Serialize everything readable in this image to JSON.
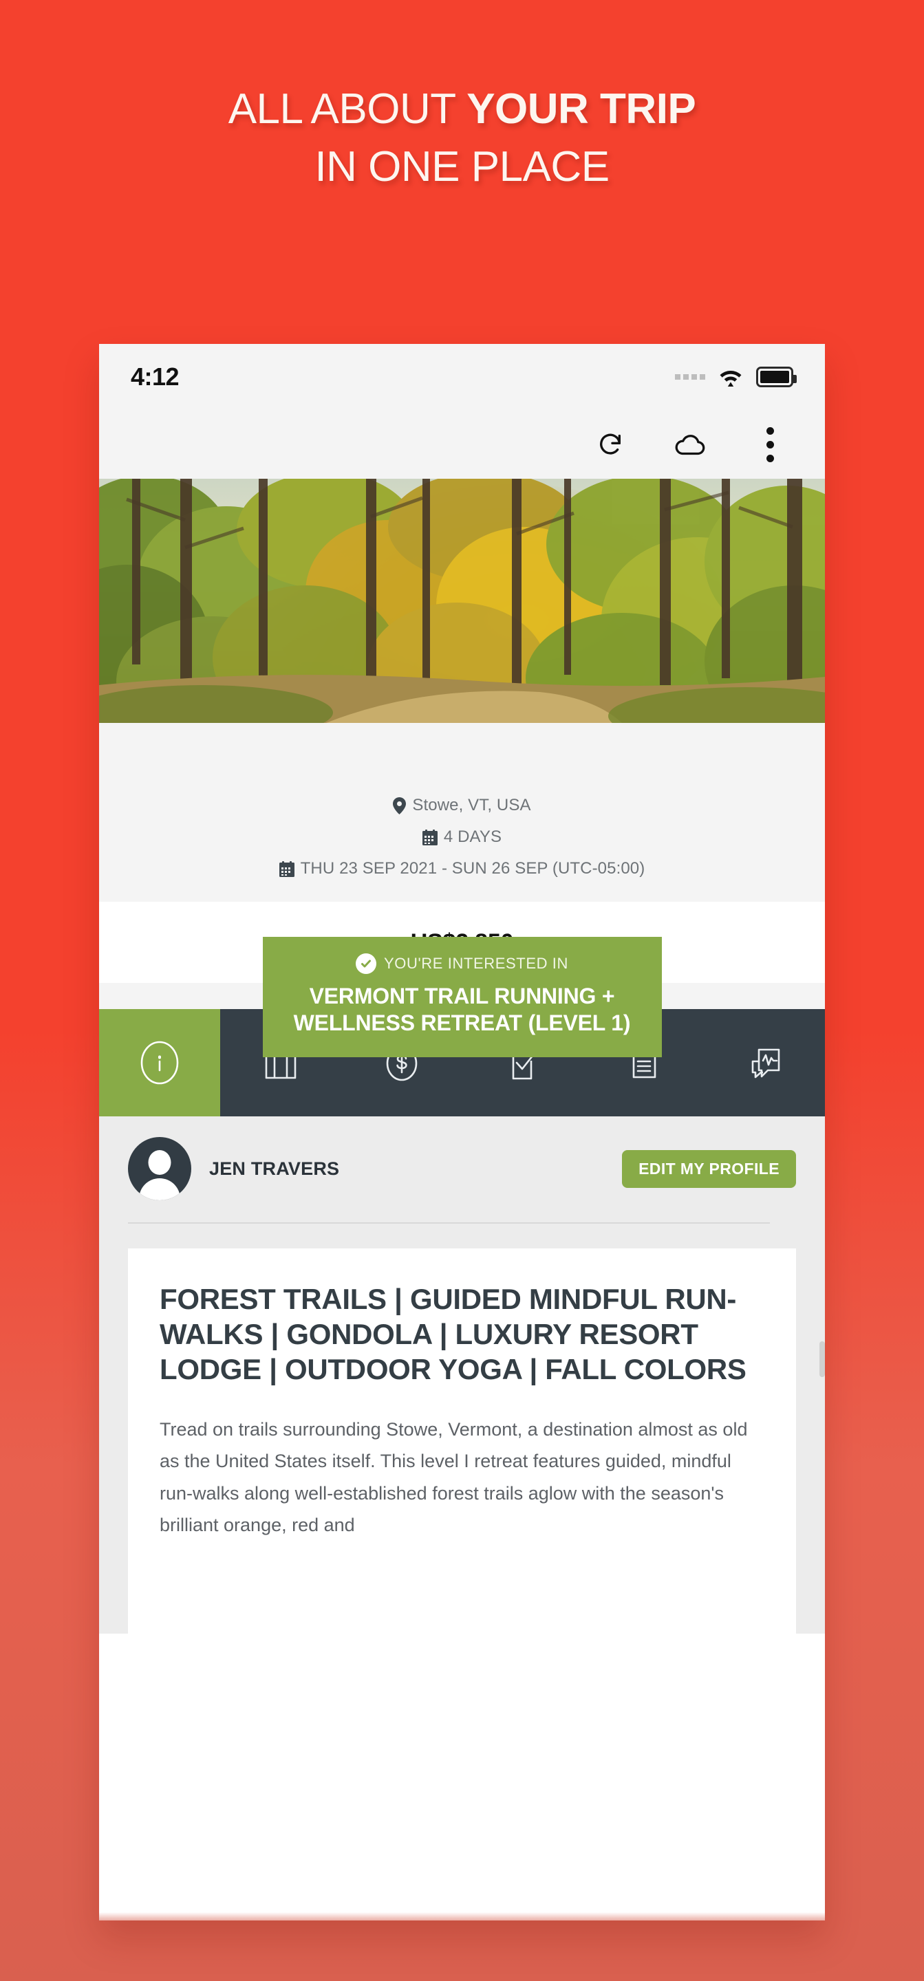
{
  "promo": {
    "line1_light": "ALL ABOUT ",
    "line1_bold": "YOUR TRIP",
    "line2": "IN ONE PLACE",
    "background_color": "#f4412e"
  },
  "status_bar": {
    "time": "4:12",
    "signal_icon": "signal-dots-icon",
    "wifi_icon": "wifi-icon",
    "battery_icon": "battery-full-icon"
  },
  "browser_toolbar": {
    "refresh_icon": "refresh-icon",
    "cloud_icon": "cloud-icon",
    "menu_icon": "overflow-menu-icon"
  },
  "hero": {
    "image_alt": "autumn-forest-photo"
  },
  "title_card": {
    "check_icon": "check-circle-icon",
    "eyebrow": "YOU'RE INTERESTED IN",
    "title": "VERMONT TRAIL RUNNING + WELLNESS RETREAT (LEVEL 1)",
    "accent_color": "#88ab47"
  },
  "trip_meta": {
    "location_icon": "map-pin-icon",
    "location": "Stowe, VT, USA",
    "duration_icon": "calendar-icon",
    "duration": "4 DAYS",
    "dates_icon": "calendar-icon",
    "dates": "THU 23 SEP 2021 - SUN 26 SEP (UTC-05:00)"
  },
  "price": {
    "amount": "US$2,850"
  },
  "tabs": [
    {
      "name": "info",
      "icon": "info-circle-icon",
      "active": true
    },
    {
      "name": "trip",
      "icon": "suitcase-icon",
      "active": false
    },
    {
      "name": "payments",
      "icon": "dollar-circle-icon",
      "active": false
    },
    {
      "name": "tasks",
      "icon": "checklist-icon",
      "active": false
    },
    {
      "name": "documents",
      "icon": "document-icon",
      "active": false
    },
    {
      "name": "messages",
      "icon": "chat-activity-icon",
      "active": false
    }
  ],
  "profile": {
    "avatar_icon": "user-avatar-icon",
    "name": "JEN TRAVERS",
    "edit_button": "EDIT MY PROFILE"
  },
  "content": {
    "heading": "FOREST TRAILS | GUIDED MINDFUL RUN-WALKS | GONDOLA | LUXURY RESORT LODGE | OUTDOOR YOGA | FALL COLORS",
    "body": "Tread on trails surrounding Stowe, Vermont, a destination almost as old as the United States itself. This level I retreat features guided, mindful run-walks along well-established forest trails aglow with the season's brilliant orange, red and"
  }
}
